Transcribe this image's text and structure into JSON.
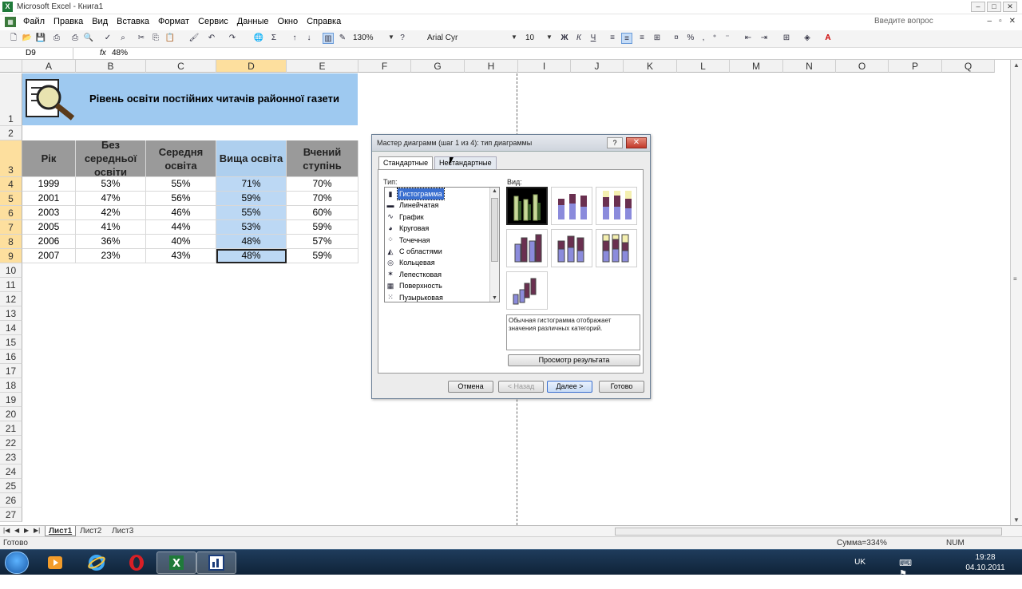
{
  "window": {
    "title": "Microsoft Excel - Книга1",
    "app_icon": "X"
  },
  "menu": {
    "items": [
      "Файл",
      "Правка",
      "Вид",
      "Вставка",
      "Формат",
      "Сервис",
      "Данные",
      "Окно",
      "Справка"
    ],
    "ask": "Введите вопрос"
  },
  "toolbar": {
    "zoom": "130%",
    "font": "Arial Cyr",
    "size": "10"
  },
  "formula": {
    "cell": "D9",
    "fx": "fx",
    "value": "48%"
  },
  "columns": [
    "A",
    "B",
    "C",
    "D",
    "E",
    "F",
    "G",
    "H",
    "I",
    "J",
    "K",
    "L",
    "M",
    "N",
    "O",
    "P",
    "Q"
  ],
  "rows": [
    "1",
    "2",
    "3",
    "4",
    "5",
    "6",
    "7",
    "8",
    "9",
    "10",
    "11",
    "12",
    "13",
    "14",
    "15",
    "16",
    "17",
    "18",
    "19",
    "20",
    "21",
    "22",
    "23",
    "24",
    "25",
    "26",
    "27"
  ],
  "sheet": {
    "title": "Рівень освіти постійних читачів районної  газети",
    "headers": [
      "Рік",
      "Без середньої освіти",
      "Середня освіта",
      "Вища освіта",
      "Вчений ступінь"
    ],
    "data": [
      [
        "1999",
        "53%",
        "55%",
        "71%",
        "70%"
      ],
      [
        "2001",
        "47%",
        "56%",
        "59%",
        "70%"
      ],
      [
        "2003",
        "42%",
        "46%",
        "55%",
        "60%"
      ],
      [
        "2005",
        "41%",
        "44%",
        "53%",
        "59%"
      ],
      [
        "2006",
        "36%",
        "40%",
        "48%",
        "57%"
      ],
      [
        "2007",
        "23%",
        "43%",
        "48%",
        "59%"
      ]
    ]
  },
  "sheet_tabs": [
    "Лист1",
    "Лист2",
    "Лист3"
  ],
  "status": {
    "ready": "Готово",
    "sum": "Сумма=334%",
    "num": "NUM"
  },
  "dialog": {
    "title": "Мастер диаграмм (шаг 1 из 4): тип диаграммы",
    "help": "?",
    "close": "✕",
    "tab_standard": "Стандартные",
    "tab_custom": "Нестандартные",
    "type_label": "Тип:",
    "view_label": "Вид:",
    "types": [
      {
        "icon": "bar-chart-icon",
        "label": "Гистограмма"
      },
      {
        "icon": "hbar-chart-icon",
        "label": "Линейчатая"
      },
      {
        "icon": "line-chart-icon",
        "label": "График"
      },
      {
        "icon": "pie-chart-icon",
        "label": "Круговая"
      },
      {
        "icon": "scatter-chart-icon",
        "label": "Точечная"
      },
      {
        "icon": "area-chart-icon",
        "label": "С областями"
      },
      {
        "icon": "doughnut-chart-icon",
        "label": "Кольцевая"
      },
      {
        "icon": "radar-chart-icon",
        "label": "Лепестковая"
      },
      {
        "icon": "surface-chart-icon",
        "label": "Поверхность"
      },
      {
        "icon": "bubble-chart-icon",
        "label": "Пузырьковая"
      }
    ],
    "description": "Обычная гистограмма отображает значения различных категорий.",
    "preview": "Просмотр результата",
    "cancel": "Отмена",
    "back": "< Назад",
    "next": "Далее >",
    "finish": "Готово"
  },
  "taskbar": {
    "lang": "UK",
    "time": "19:28",
    "date": "04.10.2011"
  },
  "colors": {
    "accent": "#3a6fd0",
    "title_band": "#9ec9f0",
    "header_gray": "#9a9a9a",
    "selection": "#bcd8f4"
  }
}
